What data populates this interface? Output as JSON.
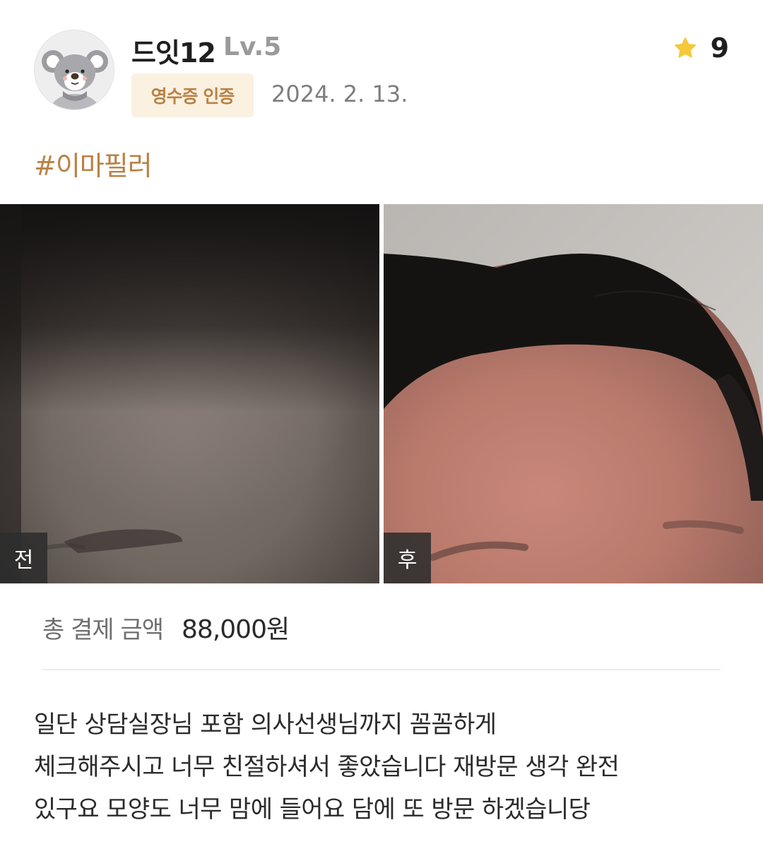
{
  "review": {
    "author": {
      "name": "드잇12",
      "level": "Lv.5",
      "avatar": "koala-avatar"
    },
    "verified_badge": "영수증 인증",
    "date": "2024. 2. 13.",
    "rating": {
      "icon": "star-icon",
      "value": "9",
      "color": "#f6c83b"
    },
    "hashtag": "#이마필러",
    "photos": [
      {
        "label": "전"
      },
      {
        "label": "후"
      }
    ],
    "payment": {
      "label": "총 결제 금액",
      "amount": "88,000원"
    },
    "body_lines": [
      "일단 상담실장님 포함 의사선생님까지 꼼꼼하게",
      "체크해주시고 너무 친절하셔서 좋았습니다 재방문 생각 완전",
      "있구요 모양도 너무 맘에 들어요 담에 또 방문 하겠습니당"
    ]
  },
  "colors": {
    "accent": "#b98245",
    "badge_bg": "#fbf1e1",
    "muted_text": "#7e7e7e"
  }
}
